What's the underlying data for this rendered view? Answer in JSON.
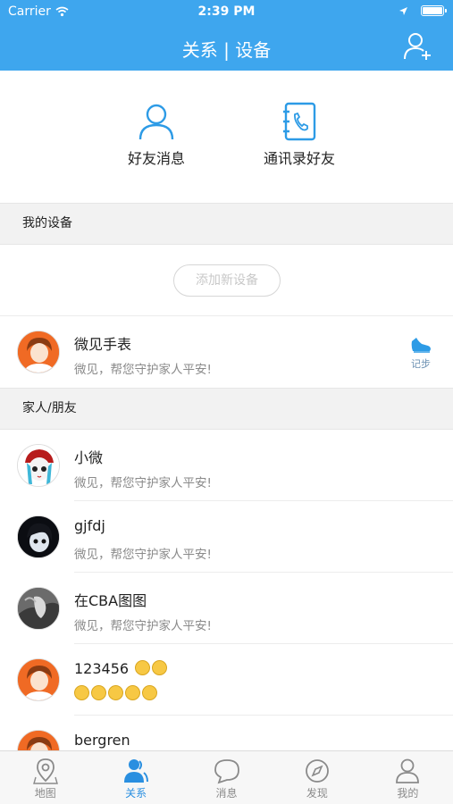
{
  "status_bar": {
    "carrier": "Carrier",
    "time": "2:39 PM"
  },
  "nav": {
    "title": "关系 | 设备",
    "add_friend_icon": "add-user-icon"
  },
  "quick_actions": [
    {
      "label": "好友消息",
      "icon": "person-icon"
    },
    {
      "label": "通讯录好友",
      "icon": "contacts-book-icon"
    }
  ],
  "devices_section": {
    "title": "我的设备",
    "add_button": "添加新设备"
  },
  "device": {
    "name": "微见手表",
    "subtitle": "微见，帮您守护家人平安!",
    "action_label": "记步"
  },
  "friends_section": {
    "title": "家人/朋友"
  },
  "friends": [
    {
      "name": "小微",
      "subtitle": "微见，帮您守护家人平安!"
    },
    {
      "name": "gjfdj",
      "subtitle": "微见，帮您守护家人平安!"
    },
    {
      "name": "在CBA图图",
      "subtitle": "微见，帮您守护家人平安!"
    },
    {
      "name": "123456",
      "subtitle": ""
    },
    {
      "name": "bergren",
      "subtitle": ""
    }
  ],
  "tabs": [
    {
      "label": "地图",
      "icon": "map-pin-icon",
      "active": false
    },
    {
      "label": "关系",
      "icon": "contacts-icon",
      "active": true
    },
    {
      "label": "消息",
      "icon": "message-bubble-icon",
      "active": false
    },
    {
      "label": "发现",
      "icon": "compass-icon",
      "active": false
    },
    {
      "label": "我的",
      "icon": "profile-icon",
      "active": false
    }
  ],
  "colors": {
    "brand": "#3ea6ee",
    "active_tab": "#2a8fe0",
    "emoji": "#f7c844"
  }
}
